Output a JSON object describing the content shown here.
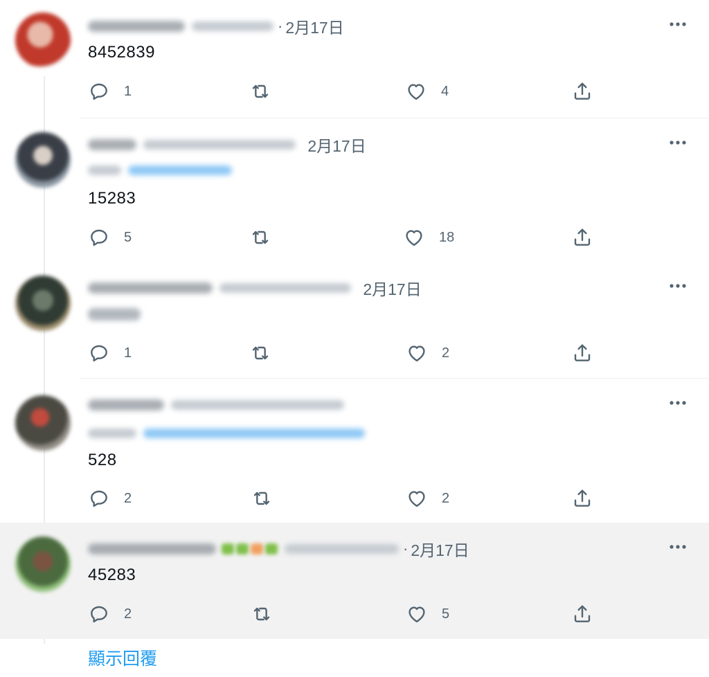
{
  "tweets": [
    {
      "date": "2月17日",
      "text": "8452839",
      "replies": "1",
      "likes": "4",
      "avatar_color": "#c0392b"
    },
    {
      "date": "2月17日",
      "text": "15283",
      "replies": "5",
      "likes": "18",
      "avatar_color": "#5d6d7e"
    },
    {
      "date": "2月17日",
      "replies": "1",
      "likes": "2",
      "avatar_color": "#3d4f3f"
    },
    {
      "text": "528",
      "replies": "2",
      "likes": "2",
      "avatar_color": "#6e5a4b"
    },
    {
      "date": "2月17日",
      "text": "45283",
      "replies": "2",
      "likes": "5",
      "avatar_color": "#6f9a5b"
    }
  ],
  "show_replies": "顯示回覆",
  "colors": {
    "accent": "#1d9bf0",
    "muted": "#536471",
    "highlight_bg": "#f2f2f2"
  }
}
